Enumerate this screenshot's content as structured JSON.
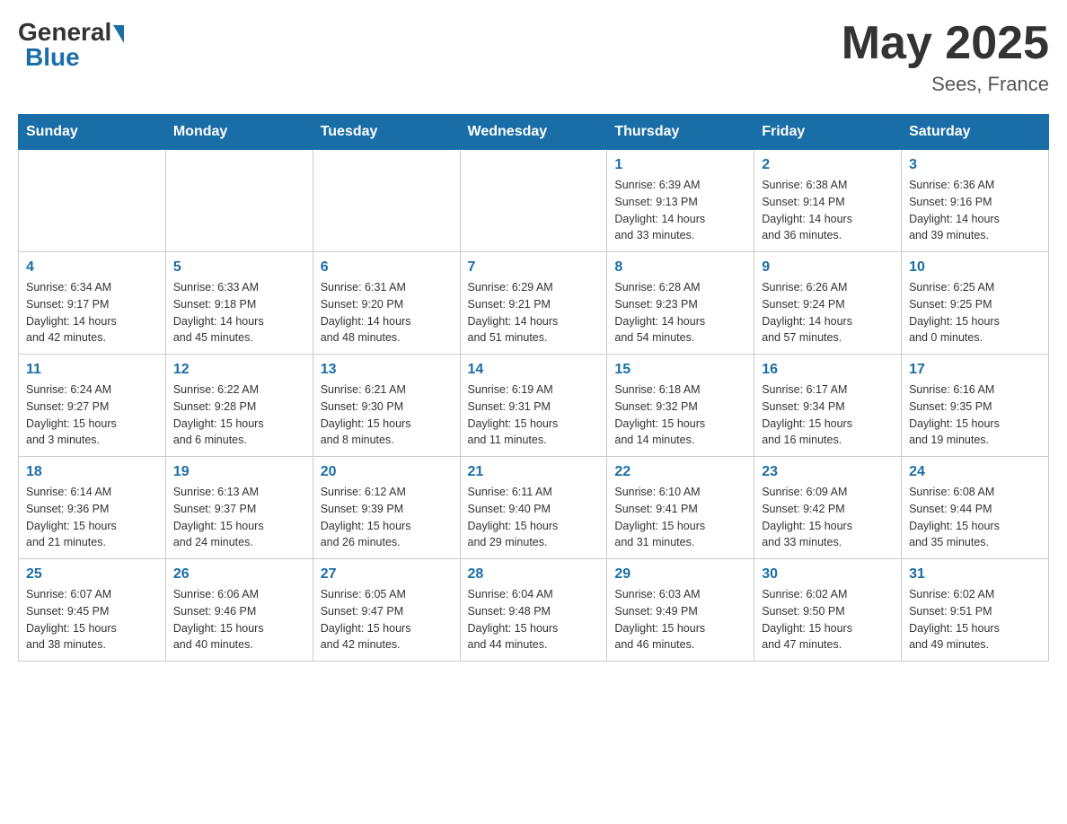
{
  "header": {
    "logo_general": "General",
    "logo_blue": "Blue",
    "month_year": "May 2025",
    "location": "Sees, France"
  },
  "weekdays": [
    "Sunday",
    "Monday",
    "Tuesday",
    "Wednesday",
    "Thursday",
    "Friday",
    "Saturday"
  ],
  "weeks": [
    [
      {
        "day": "",
        "info": ""
      },
      {
        "day": "",
        "info": ""
      },
      {
        "day": "",
        "info": ""
      },
      {
        "day": "",
        "info": ""
      },
      {
        "day": "1",
        "info": "Sunrise: 6:39 AM\nSunset: 9:13 PM\nDaylight: 14 hours\nand 33 minutes."
      },
      {
        "day": "2",
        "info": "Sunrise: 6:38 AM\nSunset: 9:14 PM\nDaylight: 14 hours\nand 36 minutes."
      },
      {
        "day": "3",
        "info": "Sunrise: 6:36 AM\nSunset: 9:16 PM\nDaylight: 14 hours\nand 39 minutes."
      }
    ],
    [
      {
        "day": "4",
        "info": "Sunrise: 6:34 AM\nSunset: 9:17 PM\nDaylight: 14 hours\nand 42 minutes."
      },
      {
        "day": "5",
        "info": "Sunrise: 6:33 AM\nSunset: 9:18 PM\nDaylight: 14 hours\nand 45 minutes."
      },
      {
        "day": "6",
        "info": "Sunrise: 6:31 AM\nSunset: 9:20 PM\nDaylight: 14 hours\nand 48 minutes."
      },
      {
        "day": "7",
        "info": "Sunrise: 6:29 AM\nSunset: 9:21 PM\nDaylight: 14 hours\nand 51 minutes."
      },
      {
        "day": "8",
        "info": "Sunrise: 6:28 AM\nSunset: 9:23 PM\nDaylight: 14 hours\nand 54 minutes."
      },
      {
        "day": "9",
        "info": "Sunrise: 6:26 AM\nSunset: 9:24 PM\nDaylight: 14 hours\nand 57 minutes."
      },
      {
        "day": "10",
        "info": "Sunrise: 6:25 AM\nSunset: 9:25 PM\nDaylight: 15 hours\nand 0 minutes."
      }
    ],
    [
      {
        "day": "11",
        "info": "Sunrise: 6:24 AM\nSunset: 9:27 PM\nDaylight: 15 hours\nand 3 minutes."
      },
      {
        "day": "12",
        "info": "Sunrise: 6:22 AM\nSunset: 9:28 PM\nDaylight: 15 hours\nand 6 minutes."
      },
      {
        "day": "13",
        "info": "Sunrise: 6:21 AM\nSunset: 9:30 PM\nDaylight: 15 hours\nand 8 minutes."
      },
      {
        "day": "14",
        "info": "Sunrise: 6:19 AM\nSunset: 9:31 PM\nDaylight: 15 hours\nand 11 minutes."
      },
      {
        "day": "15",
        "info": "Sunrise: 6:18 AM\nSunset: 9:32 PM\nDaylight: 15 hours\nand 14 minutes."
      },
      {
        "day": "16",
        "info": "Sunrise: 6:17 AM\nSunset: 9:34 PM\nDaylight: 15 hours\nand 16 minutes."
      },
      {
        "day": "17",
        "info": "Sunrise: 6:16 AM\nSunset: 9:35 PM\nDaylight: 15 hours\nand 19 minutes."
      }
    ],
    [
      {
        "day": "18",
        "info": "Sunrise: 6:14 AM\nSunset: 9:36 PM\nDaylight: 15 hours\nand 21 minutes."
      },
      {
        "day": "19",
        "info": "Sunrise: 6:13 AM\nSunset: 9:37 PM\nDaylight: 15 hours\nand 24 minutes."
      },
      {
        "day": "20",
        "info": "Sunrise: 6:12 AM\nSunset: 9:39 PM\nDaylight: 15 hours\nand 26 minutes."
      },
      {
        "day": "21",
        "info": "Sunrise: 6:11 AM\nSunset: 9:40 PM\nDaylight: 15 hours\nand 29 minutes."
      },
      {
        "day": "22",
        "info": "Sunrise: 6:10 AM\nSunset: 9:41 PM\nDaylight: 15 hours\nand 31 minutes."
      },
      {
        "day": "23",
        "info": "Sunrise: 6:09 AM\nSunset: 9:42 PM\nDaylight: 15 hours\nand 33 minutes."
      },
      {
        "day": "24",
        "info": "Sunrise: 6:08 AM\nSunset: 9:44 PM\nDaylight: 15 hours\nand 35 minutes."
      }
    ],
    [
      {
        "day": "25",
        "info": "Sunrise: 6:07 AM\nSunset: 9:45 PM\nDaylight: 15 hours\nand 38 minutes."
      },
      {
        "day": "26",
        "info": "Sunrise: 6:06 AM\nSunset: 9:46 PM\nDaylight: 15 hours\nand 40 minutes."
      },
      {
        "day": "27",
        "info": "Sunrise: 6:05 AM\nSunset: 9:47 PM\nDaylight: 15 hours\nand 42 minutes."
      },
      {
        "day": "28",
        "info": "Sunrise: 6:04 AM\nSunset: 9:48 PM\nDaylight: 15 hours\nand 44 minutes."
      },
      {
        "day": "29",
        "info": "Sunrise: 6:03 AM\nSunset: 9:49 PM\nDaylight: 15 hours\nand 46 minutes."
      },
      {
        "day": "30",
        "info": "Sunrise: 6:02 AM\nSunset: 9:50 PM\nDaylight: 15 hours\nand 47 minutes."
      },
      {
        "day": "31",
        "info": "Sunrise: 6:02 AM\nSunset: 9:51 PM\nDaylight: 15 hours\nand 49 minutes."
      }
    ]
  ]
}
